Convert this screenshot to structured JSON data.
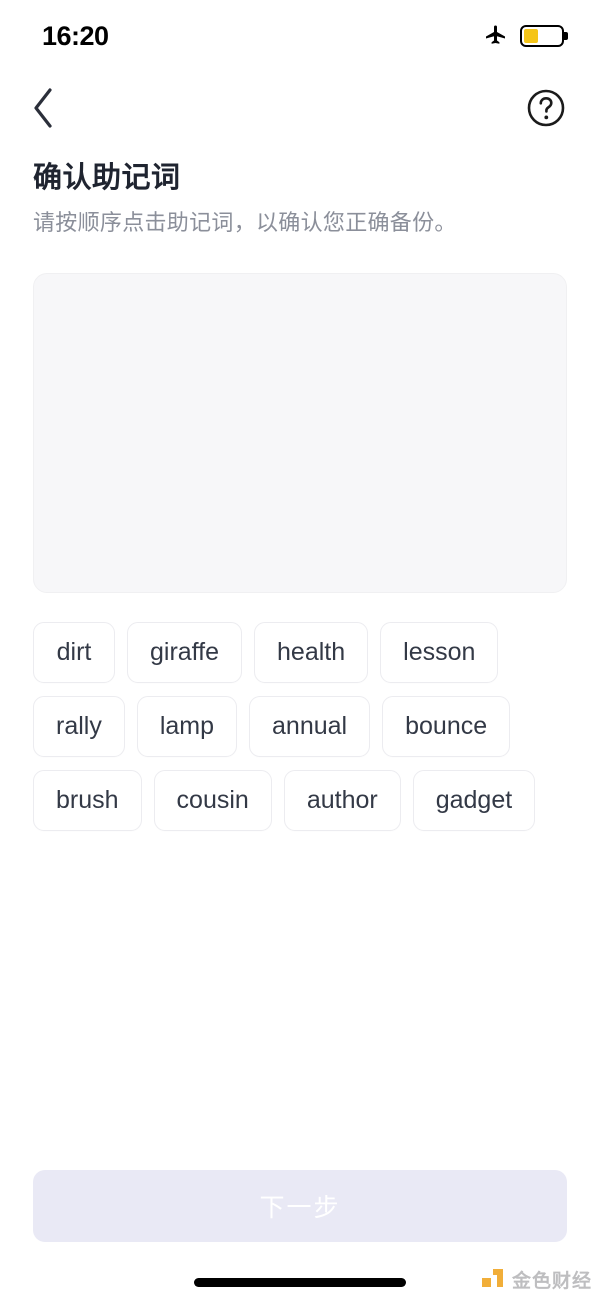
{
  "status_bar": {
    "time": "16:20",
    "airplane_icon": "airplane-mode-icon",
    "battery_icon": "battery-icon",
    "battery_level_percent": 40,
    "battery_fill_color": "#f5c518"
  },
  "nav_bar": {
    "back_icon": "chevron-left-icon",
    "help_icon": "question-mark-circle-icon"
  },
  "heading": {
    "title": "确认助记词",
    "subtitle": "请按顺序点击助记词，以确认您正确备份。"
  },
  "drop_area": {
    "selected_words": [],
    "placeholder": ""
  },
  "word_bank": {
    "words": [
      "dirt",
      "giraffe",
      "health",
      "lesson",
      "rally",
      "lamp",
      "annual",
      "bounce",
      "brush",
      "cousin",
      "author",
      "gadget"
    ]
  },
  "footer": {
    "next_label": "下一步",
    "next_enabled": false,
    "next_bg_color": "#e9e9f5",
    "next_text_color": "#ffffff"
  },
  "watermark": {
    "text": "金色财经",
    "logo_color": "#f0a829"
  }
}
